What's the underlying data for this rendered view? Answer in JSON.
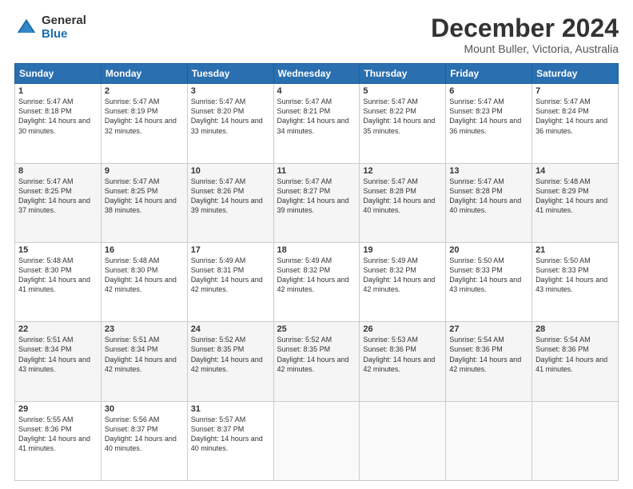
{
  "logo": {
    "general": "General",
    "blue": "Blue"
  },
  "title": {
    "month": "December 2024",
    "location": "Mount Buller, Victoria, Australia"
  },
  "weekdays": [
    "Sunday",
    "Monday",
    "Tuesday",
    "Wednesday",
    "Thursday",
    "Friday",
    "Saturday"
  ],
  "weeks": [
    [
      {
        "day": "1",
        "rise": "5:47 AM",
        "set": "8:18 PM",
        "daylight": "14 hours and 30 minutes."
      },
      {
        "day": "2",
        "rise": "5:47 AM",
        "set": "8:19 PM",
        "daylight": "14 hours and 32 minutes."
      },
      {
        "day": "3",
        "rise": "5:47 AM",
        "set": "8:20 PM",
        "daylight": "14 hours and 33 minutes."
      },
      {
        "day": "4",
        "rise": "5:47 AM",
        "set": "8:21 PM",
        "daylight": "14 hours and 34 minutes."
      },
      {
        "day": "5",
        "rise": "5:47 AM",
        "set": "8:22 PM",
        "daylight": "14 hours and 35 minutes."
      },
      {
        "day": "6",
        "rise": "5:47 AM",
        "set": "8:23 PM",
        "daylight": "14 hours and 36 minutes."
      },
      {
        "day": "7",
        "rise": "5:47 AM",
        "set": "8:24 PM",
        "daylight": "14 hours and 36 minutes."
      }
    ],
    [
      {
        "day": "8",
        "rise": "5:47 AM",
        "set": "8:25 PM",
        "daylight": "14 hours and 37 minutes."
      },
      {
        "day": "9",
        "rise": "5:47 AM",
        "set": "8:25 PM",
        "daylight": "14 hours and 38 minutes."
      },
      {
        "day": "10",
        "rise": "5:47 AM",
        "set": "8:26 PM",
        "daylight": "14 hours and 39 minutes."
      },
      {
        "day": "11",
        "rise": "5:47 AM",
        "set": "8:27 PM",
        "daylight": "14 hours and 39 minutes."
      },
      {
        "day": "12",
        "rise": "5:47 AM",
        "set": "8:28 PM",
        "daylight": "14 hours and 40 minutes."
      },
      {
        "day": "13",
        "rise": "5:47 AM",
        "set": "8:28 PM",
        "daylight": "14 hours and 40 minutes."
      },
      {
        "day": "14",
        "rise": "5:48 AM",
        "set": "8:29 PM",
        "daylight": "14 hours and 41 minutes."
      }
    ],
    [
      {
        "day": "15",
        "rise": "5:48 AM",
        "set": "8:30 PM",
        "daylight": "14 hours and 41 minutes."
      },
      {
        "day": "16",
        "rise": "5:48 AM",
        "set": "8:30 PM",
        "daylight": "14 hours and 42 minutes."
      },
      {
        "day": "17",
        "rise": "5:49 AM",
        "set": "8:31 PM",
        "daylight": "14 hours and 42 minutes."
      },
      {
        "day": "18",
        "rise": "5:49 AM",
        "set": "8:32 PM",
        "daylight": "14 hours and 42 minutes."
      },
      {
        "day": "19",
        "rise": "5:49 AM",
        "set": "8:32 PM",
        "daylight": "14 hours and 42 minutes."
      },
      {
        "day": "20",
        "rise": "5:50 AM",
        "set": "8:33 PM",
        "daylight": "14 hours and 43 minutes."
      },
      {
        "day": "21",
        "rise": "5:50 AM",
        "set": "8:33 PM",
        "daylight": "14 hours and 43 minutes."
      }
    ],
    [
      {
        "day": "22",
        "rise": "5:51 AM",
        "set": "8:34 PM",
        "daylight": "14 hours and 43 minutes."
      },
      {
        "day": "23",
        "rise": "5:51 AM",
        "set": "8:34 PM",
        "daylight": "14 hours and 42 minutes."
      },
      {
        "day": "24",
        "rise": "5:52 AM",
        "set": "8:35 PM",
        "daylight": "14 hours and 42 minutes."
      },
      {
        "day": "25",
        "rise": "5:52 AM",
        "set": "8:35 PM",
        "daylight": "14 hours and 42 minutes."
      },
      {
        "day": "26",
        "rise": "5:53 AM",
        "set": "8:36 PM",
        "daylight": "14 hours and 42 minutes."
      },
      {
        "day": "27",
        "rise": "5:54 AM",
        "set": "8:36 PM",
        "daylight": "14 hours and 42 minutes."
      },
      {
        "day": "28",
        "rise": "5:54 AM",
        "set": "8:36 PM",
        "daylight": "14 hours and 41 minutes."
      }
    ],
    [
      {
        "day": "29",
        "rise": "5:55 AM",
        "set": "8:36 PM",
        "daylight": "14 hours and 41 minutes."
      },
      {
        "day": "30",
        "rise": "5:56 AM",
        "set": "8:37 PM",
        "daylight": "14 hours and 40 minutes."
      },
      {
        "day": "31",
        "rise": "5:57 AM",
        "set": "8:37 PM",
        "daylight": "14 hours and 40 minutes."
      },
      null,
      null,
      null,
      null
    ]
  ]
}
